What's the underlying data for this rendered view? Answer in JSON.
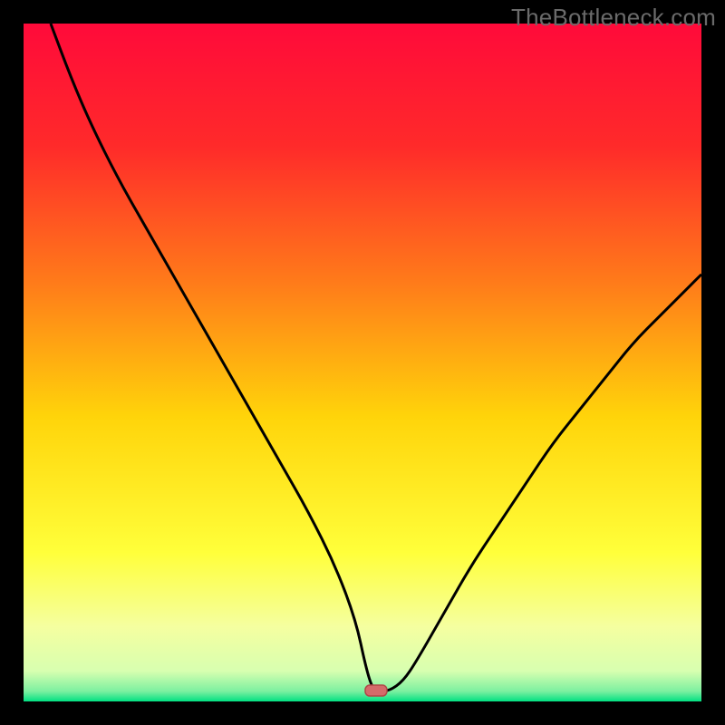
{
  "watermark": "TheBottleneck.com",
  "chart_data": {
    "type": "line",
    "title": "",
    "xlabel": "",
    "ylabel": "",
    "xlim": [
      0,
      100
    ],
    "ylim": [
      0,
      100
    ],
    "background": {
      "kind": "vertical-gradient",
      "stops": [
        {
          "pos": 0.0,
          "color": "#ff0a3a"
        },
        {
          "pos": 0.18,
          "color": "#ff2a2a"
        },
        {
          "pos": 0.38,
          "color": "#ff7a1a"
        },
        {
          "pos": 0.58,
          "color": "#ffd40a"
        },
        {
          "pos": 0.78,
          "color": "#ffff3a"
        },
        {
          "pos": 0.89,
          "color": "#f5ffa0"
        },
        {
          "pos": 0.955,
          "color": "#d8ffb0"
        },
        {
          "pos": 0.985,
          "color": "#7cf0a0"
        },
        {
          "pos": 1.0,
          "color": "#00e082"
        }
      ]
    },
    "series": [
      {
        "name": "bottleneck-curve",
        "color": "#000000",
        "width": 3,
        "x": [
          4,
          7,
          10,
          14,
          18,
          22,
          26,
          30,
          34,
          38,
          42,
          46,
          49,
          50.5,
          51.5,
          52.5,
          54,
          56,
          58,
          62,
          66,
          70,
          74,
          78,
          82,
          86,
          90,
          94,
          98,
          100
        ],
        "y": [
          100,
          92,
          85,
          77,
          70,
          63,
          56,
          49,
          42,
          35,
          28,
          20,
          12,
          5,
          1.8,
          1.5,
          1.6,
          3,
          6,
          13,
          20,
          26,
          32,
          38,
          43,
          48,
          53,
          57,
          61,
          63
        ]
      }
    ],
    "marker": {
      "name": "optimal-point",
      "x": 52,
      "y": 1.6,
      "width_x": 3.2,
      "height_y": 1.6,
      "fill": "#d46a6a",
      "stroke": "#b04848"
    }
  },
  "colors": {
    "frame": "#000000",
    "watermark": "#6a6a6a"
  }
}
